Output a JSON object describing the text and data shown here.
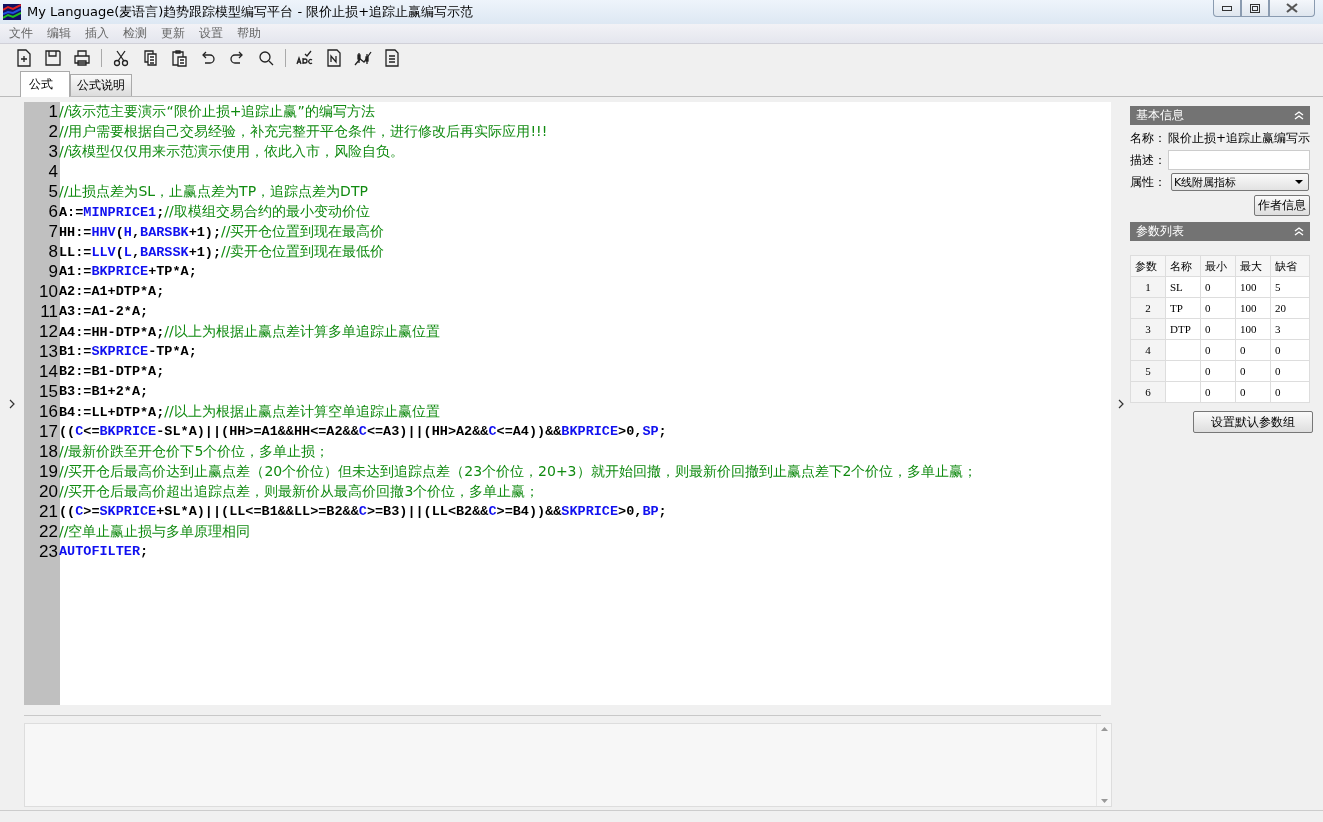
{
  "window": {
    "title": "My Language(麦语言)趋势跟踪模型编写平台 - 限价止损+追踪止赢编写示范"
  },
  "menu": [
    "文件",
    "编辑",
    "插入",
    "检测",
    "更新",
    "设置",
    "帮助"
  ],
  "tabs": [
    {
      "label": "公式",
      "selected": true
    },
    {
      "label": "公式说明",
      "selected": false
    }
  ],
  "code_lines": [
    {
      "number": "1",
      "tokens": [
        {
          "kind": "comment",
          "text": "//该示范主要演示“限价止损+追踪止赢”的编写方法"
        }
      ]
    },
    {
      "number": "2",
      "tokens": [
        {
          "kind": "comment",
          "text": "//用户需要根据自己交易经验，补充完整开平仓条件，进行修改后再实际应用!!!"
        }
      ]
    },
    {
      "number": "3",
      "tokens": [
        {
          "kind": "comment",
          "text": "//该模型仅仅用来示范演示使用，依此入市，风险自负。"
        }
      ]
    },
    {
      "number": "4"
    },
    {
      "number": "5",
      "tokens": [
        {
          "kind": "comment",
          "text": "//止损点差为SL，止赢点差为TP，追踪点差为DTP"
        }
      ]
    },
    {
      "number": "6",
      "tokens": [
        {
          "kind": "plain",
          "text": "A:="
        },
        {
          "kind": "keyword",
          "text": "MINPRICE1"
        },
        {
          "kind": "plain",
          "text": ";"
        },
        {
          "kind": "comment",
          "text": "//取模组交易合约的最小变动价位"
        }
      ]
    },
    {
      "number": "7",
      "tokens": [
        {
          "kind": "plain",
          "text": "HH:="
        },
        {
          "kind": "keyword",
          "text": "HHV"
        },
        {
          "kind": "plain",
          "text": "("
        },
        {
          "kind": "keyword",
          "text": "H"
        },
        {
          "kind": "plain",
          "text": ","
        },
        {
          "kind": "keyword",
          "text": "BARSBK"
        },
        {
          "kind": "plain",
          "text": "+1);"
        },
        {
          "kind": "comment",
          "text": "//买开仓位置到现在最高价"
        }
      ]
    },
    {
      "number": "8",
      "tokens": [
        {
          "kind": "plain",
          "text": "LL:="
        },
        {
          "kind": "keyword",
          "text": "LLV"
        },
        {
          "kind": "plain",
          "text": "("
        },
        {
          "kind": "keyword",
          "text": "L"
        },
        {
          "kind": "plain",
          "text": ","
        },
        {
          "kind": "keyword",
          "text": "BARSSK"
        },
        {
          "kind": "plain",
          "text": "+1);"
        },
        {
          "kind": "comment",
          "text": "//卖开仓位置到现在最低价"
        }
      ]
    },
    {
      "number": "9",
      "tokens": [
        {
          "kind": "plain",
          "text": "A1:="
        },
        {
          "kind": "keyword",
          "text": "BKPRICE"
        },
        {
          "kind": "plain",
          "text": "+TP*A;"
        }
      ]
    },
    {
      "number": "10",
      "tokens": [
        {
          "kind": "plain",
          "text": "A2:=A1+DTP*A;"
        }
      ]
    },
    {
      "number": "11",
      "tokens": [
        {
          "kind": "plain",
          "text": "A3:=A1-2*A;"
        }
      ]
    },
    {
      "number": "12",
      "tokens": [
        {
          "kind": "plain",
          "text": "A4:=HH-DTP*A;"
        },
        {
          "kind": "comment",
          "text": "//以上为根据止赢点差计算多单追踪止赢位置"
        }
      ]
    },
    {
      "number": "13",
      "tokens": [
        {
          "kind": "plain",
          "text": "B1:="
        },
        {
          "kind": "keyword",
          "text": "SKPRICE"
        },
        {
          "kind": "plain",
          "text": "-TP*A;"
        }
      ]
    },
    {
      "number": "14",
      "tokens": [
        {
          "kind": "plain",
          "text": "B2:=B1-DTP*A;"
        }
      ]
    },
    {
      "number": "15",
      "tokens": [
        {
          "kind": "plain",
          "text": "B3:=B1+2*A;"
        }
      ]
    },
    {
      "number": "16",
      "tokens": [
        {
          "kind": "plain",
          "text": "B4:=LL+DTP*A;"
        },
        {
          "kind": "comment",
          "text": "//以上为根据止赢点差计算空单追踪止赢位置"
        }
      ]
    },
    {
      "number": "17",
      "tokens": [
        {
          "kind": "plain",
          "text": "(("
        },
        {
          "kind": "keyword",
          "text": "C"
        },
        {
          "kind": "plain",
          "text": "<="
        },
        {
          "kind": "keyword",
          "text": "BKPRICE"
        },
        {
          "kind": "plain",
          "text": "-SL*A)||(HH>=A1&&HH<=A2&&"
        },
        {
          "kind": "keyword",
          "text": "C"
        },
        {
          "kind": "plain",
          "text": "<=A3)||(HH>A2&&"
        },
        {
          "kind": "keyword",
          "text": "C"
        },
        {
          "kind": "plain",
          "text": "<=A4))&&"
        },
        {
          "kind": "keyword",
          "text": "BKPRICE"
        },
        {
          "kind": "plain",
          "text": ">0,"
        },
        {
          "kind": "keyword",
          "text": "SP"
        },
        {
          "kind": "plain",
          "text": ";"
        }
      ]
    },
    {
      "number": "18",
      "tokens": [
        {
          "kind": "comment",
          "text": "//最新价跌至开仓价下5个价位，多单止损；"
        }
      ]
    },
    {
      "number": "19",
      "tokens": [
        {
          "kind": "comment",
          "text": "//买开仓后最高价达到止赢点差（20个价位）但未达到追踪点差（23个价位，20+3）就开始回撤，则最新价回撤到止赢点差下2个价位，多单止赢；"
        }
      ]
    },
    {
      "number": "20",
      "tokens": [
        {
          "kind": "comment",
          "text": "//买开仓后最高价超出追踪点差，则最新价从最高价回撤3个价位，多单止赢；"
        }
      ]
    },
    {
      "number": "21",
      "tokens": [
        {
          "kind": "plain",
          "text": "(("
        },
        {
          "kind": "keyword",
          "text": "C"
        },
        {
          "kind": "plain",
          "text": ">="
        },
        {
          "kind": "keyword",
          "text": "SKPRICE"
        },
        {
          "kind": "plain",
          "text": "+SL*A)||(LL<=B1&&LL>=B2&&"
        },
        {
          "kind": "keyword",
          "text": "C"
        },
        {
          "kind": "plain",
          "text": ">=B3)||(LL<B2&&"
        },
        {
          "kind": "keyword",
          "text": "C"
        },
        {
          "kind": "plain",
          "text": ">=B4))&&"
        },
        {
          "kind": "keyword",
          "text": "SKPRICE"
        },
        {
          "kind": "plain",
          "text": ">0,"
        },
        {
          "kind": "keyword",
          "text": "BP"
        },
        {
          "kind": "plain",
          "text": ";"
        }
      ]
    },
    {
      "number": "22",
      "tokens": [
        {
          "kind": "comment",
          "text": "//空单止赢止损与多单原理相同"
        }
      ]
    },
    {
      "number": "23",
      "tokens": [
        {
          "kind": "keyword",
          "text": "AUTOFILTER"
        },
        {
          "kind": "plain",
          "text": ";"
        }
      ]
    }
  ],
  "info_panel": {
    "title": "基本信息",
    "name_label": "名称：",
    "name_value": "限价止损+追踪止赢编写示",
    "desc_label": "描述：",
    "attr_label": "属性：",
    "attr_value": "K线附属指标",
    "author_button": "作者信息"
  },
  "params_panel": {
    "title": "参数列表",
    "columns": [
      "参数",
      "名称",
      "最小",
      "最大",
      "缺省"
    ],
    "rows": [
      {
        "index": "1",
        "name": "SL",
        "min": "0",
        "max": "100",
        "default": "5"
      },
      {
        "index": "2",
        "name": "TP",
        "min": "0",
        "max": "100",
        "default": "20"
      },
      {
        "index": "3",
        "name": "DTP",
        "min": "0",
        "max": "100",
        "default": "3"
      },
      {
        "index": "4",
        "min": "0",
        "max": "0",
        "default": "0"
      },
      {
        "index": "5",
        "min": "0",
        "max": "0",
        "default": "0"
      },
      {
        "index": "6",
        "min": "0",
        "max": "0",
        "default": "0"
      }
    ],
    "default_button": "设置默认参数组"
  }
}
